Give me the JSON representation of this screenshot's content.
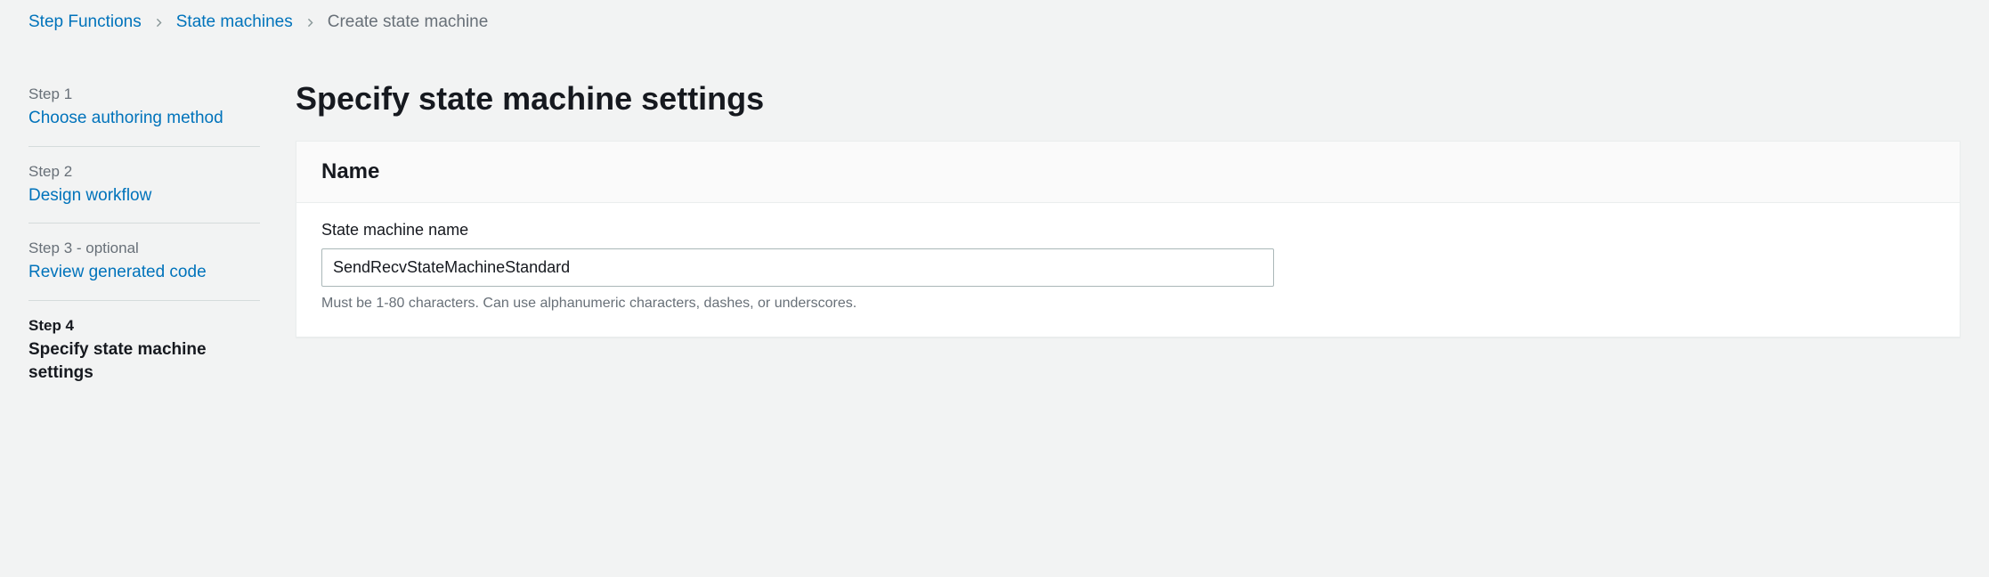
{
  "breadcrumb": {
    "items": [
      {
        "label": "Step Functions",
        "link": true
      },
      {
        "label": "State machines",
        "link": true
      },
      {
        "label": "Create state machine",
        "link": false
      }
    ]
  },
  "sidebar": {
    "steps": [
      {
        "number": "Step 1",
        "title": "Choose authoring method",
        "active": false
      },
      {
        "number": "Step 2",
        "title": "Design workflow",
        "active": false
      },
      {
        "number": "Step 3 - optional",
        "title": "Review generated code",
        "active": false
      },
      {
        "number": "Step 4",
        "title": "Specify state machine settings",
        "active": true
      }
    ]
  },
  "main": {
    "page_title": "Specify state machine settings",
    "panel": {
      "header": "Name",
      "field_label": "State machine name",
      "field_value": "SendRecvStateMachineStandard",
      "hint": "Must be 1-80 characters. Can use alphanumeric characters, dashes, or underscores."
    }
  }
}
